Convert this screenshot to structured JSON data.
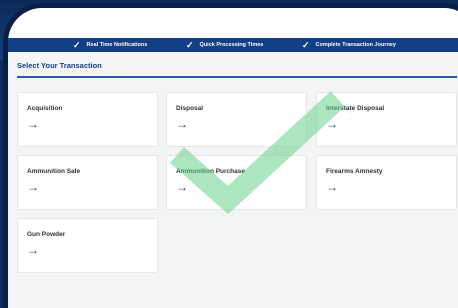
{
  "banner": {
    "items": [
      "Real Time Notifications",
      "Quick Processing Times",
      "Complete Transaction Journey"
    ]
  },
  "page": {
    "title": "Select Your Transaction"
  },
  "cards": [
    {
      "label": "Acquisition",
      "arrow": "→"
    },
    {
      "label": "Disposal",
      "arrow": "→"
    },
    {
      "label": "Interstate Disposal",
      "arrow": "→"
    },
    {
      "label": "Ammunition Sale",
      "arrow": "→"
    },
    {
      "label": "Ammunition Purchase",
      "arrow": "→"
    },
    {
      "label": "Firearms Amnesty",
      "arrow": "→"
    },
    {
      "label": "Gun Powder",
      "arrow": "→"
    }
  ],
  "icons": {
    "banner_check": "checkmark-icon",
    "card_arrow": "arrow-right-icon",
    "watermark": "checkmark-icon"
  },
  "colors": {
    "brand_blue": "#163f86",
    "banner_blue": "#123f86",
    "watermark_green": "#67d18a"
  }
}
